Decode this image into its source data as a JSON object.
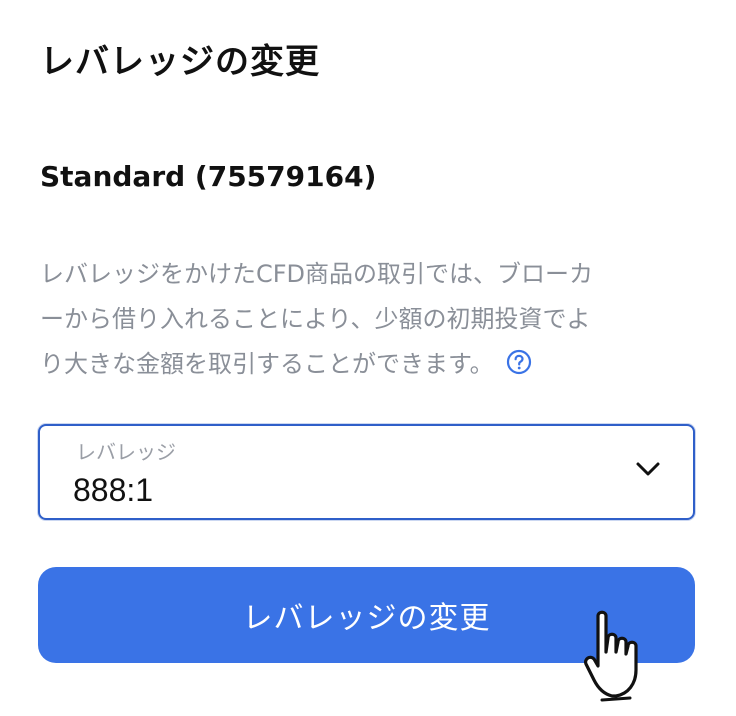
{
  "header": {
    "title": "レバレッジの変更"
  },
  "account": {
    "label": "Standard (75579164)"
  },
  "description": {
    "line1": "レバレッジをかけたCFD商品の取引では、ブローカ",
    "line2": "ーから借り入れることにより、少額の初期投資でよ",
    "line3": "り大きな金額を取引することができます。",
    "help_icon": "question-circle-icon"
  },
  "leverage_select": {
    "label": "レバレッジ",
    "value": "888:1",
    "icon": "chevron-down-icon"
  },
  "submit": {
    "label": "レバレッジの変更"
  },
  "colors": {
    "accent": "#3a73e6",
    "border_focus": "#2f5fc9",
    "muted_text": "#8a8f98"
  }
}
